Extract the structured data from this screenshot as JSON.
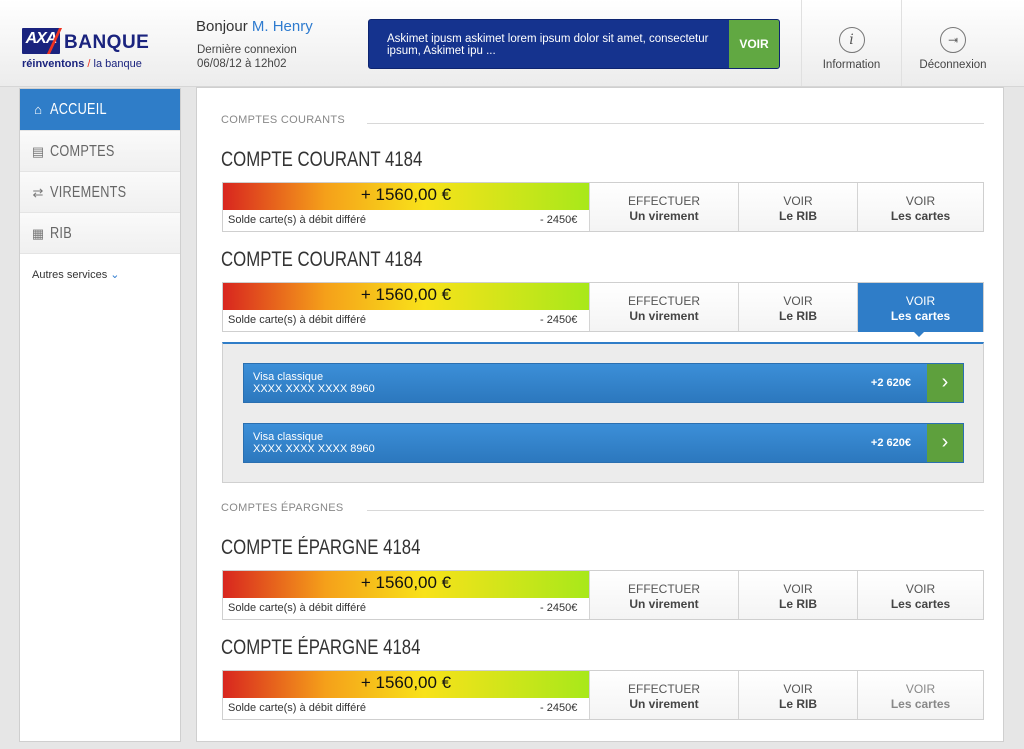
{
  "header": {
    "logo": {
      "brand": "AXA",
      "name": "BANQUE",
      "slogan_bold": "réinventons",
      "slogan_rest": "la banque"
    },
    "greeting": "Bonjour",
    "user_name": "M. Henry",
    "last_login_label": "Dernière connexion",
    "last_login_value": "06/08/12 à 12h02",
    "message": "Askimet ipusm askimet lorem ipsum dolor sit amet, consectetur ipsum, Askimet ipu ...",
    "message_button": "VOIR",
    "info_label": "Information",
    "logout_label": "Déconnexion"
  },
  "sidebar": {
    "items": [
      {
        "label": "ACCUEIL",
        "icon": "home-icon",
        "active": true
      },
      {
        "label": "COMPTES",
        "icon": "accounts-icon",
        "active": false
      },
      {
        "label": "VIREMENTS",
        "icon": "transfer-icon",
        "active": false
      },
      {
        "label": "RIB",
        "icon": "rib-icon",
        "active": false
      }
    ],
    "others": "Autres services"
  },
  "sections": {
    "courants": "COMPTES COURANTS",
    "epargnes": "COMPTES ÉPARGNES"
  },
  "accounts": [
    {
      "title": "COMPTE COURANT 4184",
      "amount": "+ 1560,00 €",
      "solde_label": "Solde carte(s) à débit différé",
      "debit": "- 2450€"
    },
    {
      "title": "COMPTE COURANT 4184",
      "amount": "+ 1560,00 €",
      "solde_label": "Solde carte(s) à débit différé",
      "debit": "- 2450€"
    },
    {
      "title": "COMPTE ÉPARGNE 4184",
      "amount": "+ 1560,00 €",
      "solde_label": "Solde carte(s) à débit différé",
      "debit": "- 2450€"
    },
    {
      "title": "COMPTE ÉPARGNE 4184",
      "amount": "+ 1560,00 €",
      "solde_label": "Solde carte(s) à débit différé",
      "debit": "- 2450€"
    }
  ],
  "actions": {
    "virement_top": "EFFECTUER",
    "virement_bottom": "Un virement",
    "rib_top": "VOIR",
    "rib_bottom": "Le RIB",
    "cartes_top": "VOIR",
    "cartes_bottom": "Les cartes"
  },
  "cards": [
    {
      "type": "Visa classique",
      "number": "XXXX XXXX XXXX 8960",
      "amount": "+2 620€"
    },
    {
      "type": "Visa classique",
      "number": "XXXX XXXX XXXX 8960",
      "amount": "+2 620€"
    }
  ],
  "colors": {
    "primary": "#2f7dc8",
    "navy": "#15338e",
    "green": "#61a842"
  }
}
